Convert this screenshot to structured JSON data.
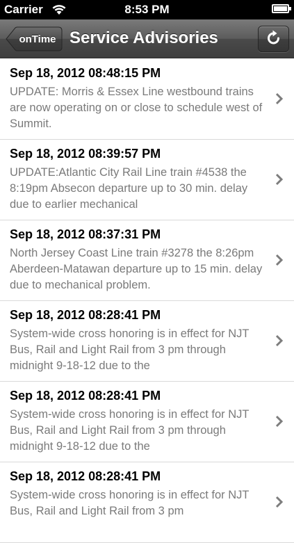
{
  "status_bar": {
    "carrier": "Carrier",
    "time": "8:53 PM"
  },
  "nav": {
    "back_label": "onTime",
    "title": "Service Advisories"
  },
  "advisories": [
    {
      "date": "Sep 18, 2012 08:48:15 PM",
      "text": "UPDATE: Morris & Essex Line westbound trains are now operating on or close to schedule west of Summit."
    },
    {
      "date": "Sep 18, 2012 08:39:57 PM",
      "text": "UPDATE:Atlantic City Rail Line train #4538 the 8:19pm Absecon departure up to 30 min. delay due to earlier mechanical"
    },
    {
      "date": "Sep 18, 2012 08:37:31 PM",
      "text": "North Jersey Coast Line train #3278 the 8:26pm Aberdeen-Matawan departure up to 15 min. delay due to mechanical problem."
    },
    {
      "date": "Sep 18, 2012 08:28:41 PM",
      "text": "System-wide cross honoring is in effect for NJT Bus, Rail and Light Rail from 3 pm through midnight 9-18-12 due to the"
    },
    {
      "date": "Sep 18, 2012 08:28:41 PM",
      "text": "System-wide cross honoring is in effect for NJT Bus, Rail and Light Rail from 3 pm through midnight 9-18-12 due to the"
    },
    {
      "date": "Sep 18, 2012 08:28:41 PM",
      "text": "System-wide cross honoring is in effect for NJT Bus, Rail and Light Rail from 3 pm"
    }
  ]
}
